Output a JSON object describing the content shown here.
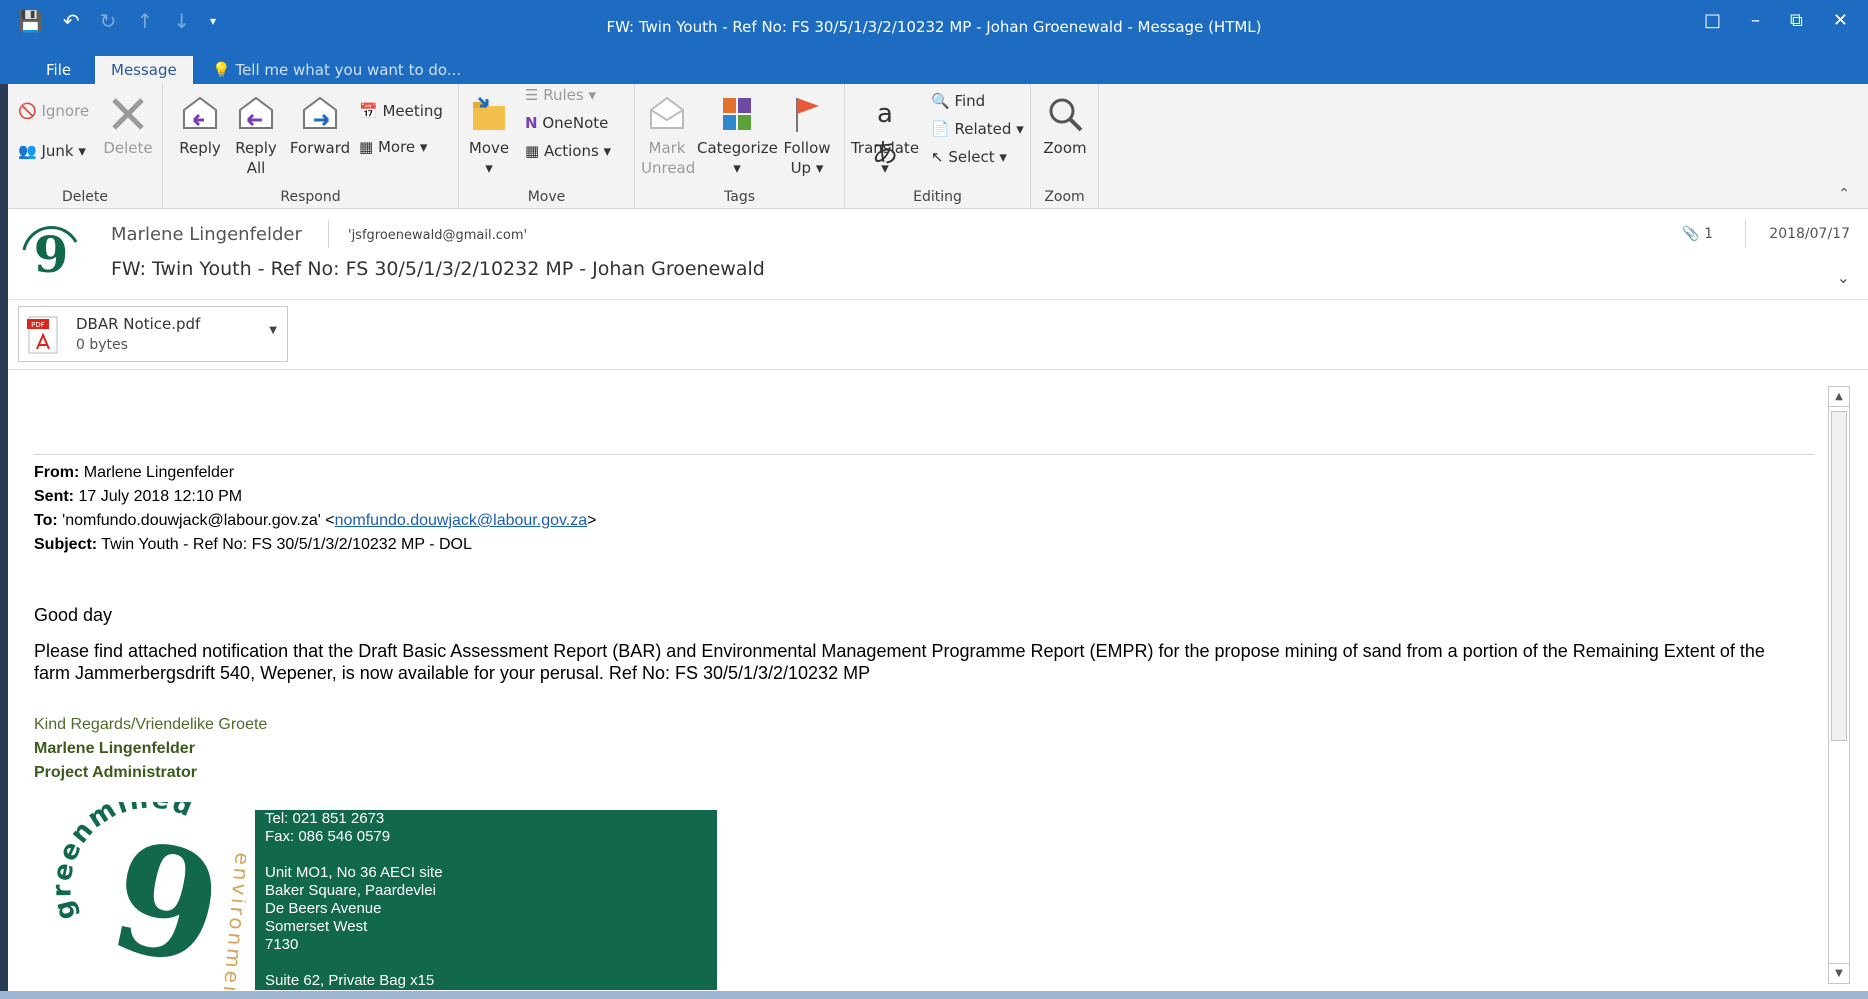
{
  "window": {
    "title": "FW: Twin Youth - Ref No: FS 30/5/1/3/2/10232 MP - Johan Groenewald - Message (HTML)"
  },
  "tabs": {
    "file": "File",
    "message": "Message",
    "tell_me": "Tell me what you want to do..."
  },
  "ribbon": {
    "delete_group": {
      "label": "Delete",
      "ignore": "Ignore",
      "junk": "Junk",
      "delete": "Delete"
    },
    "respond_group": {
      "label": "Respond",
      "reply": "Reply",
      "reply_all_1": "Reply",
      "reply_all_2": "All",
      "forward": "Forward",
      "meeting": "Meeting",
      "more": "More"
    },
    "move_group": {
      "label": "Move",
      "move": "Move",
      "rules": "Rules",
      "onenote": "OneNote",
      "actions": "Actions"
    },
    "tags_group": {
      "label": "Tags",
      "mark_1": "Mark",
      "mark_2": "Unread",
      "categorize": "Categorize",
      "follow_1": "Follow",
      "follow_2": "Up"
    },
    "editing_group": {
      "label": "Editing",
      "translate": "Translate",
      "find": "Find",
      "related": "Related",
      "select": "Select"
    },
    "zoom_group": {
      "label": "Zoom",
      "zoom": "Zoom"
    }
  },
  "message_header": {
    "sender": "Marlene Lingenfelder",
    "recipient": "'jsfgroenewald@gmail.com'",
    "subject": "FW: Twin Youth - Ref No: FS 30/5/1/3/2/10232 MP - Johan Groenewald",
    "attachment_count": "1",
    "date": "2018/07/17"
  },
  "attachment": {
    "name": "DBAR Notice.pdf",
    "size": "0 bytes"
  },
  "body": {
    "from_label": "From:",
    "from_value": "Marlene Lingenfelder",
    "sent_label": "Sent:",
    "sent_value": "17 July 2018 12:10 PM",
    "to_label": "To:",
    "to_value": "'nomfundo.douwjack@labour.gov.za' <",
    "to_link": "nomfundo.douwjack@labour.gov.za",
    "to_close": ">",
    "subject_label": "Subject:",
    "subject_value": "Twin Youth - Ref No: FS 30/5/1/3/2/10232 MP - DOL",
    "greeting": "Good day",
    "paragraph": "Please find attached notification that the Draft Basic Assessment Report (BAR) and Environmental Management Programme Report (EMPR) for the propose mining of sand from a portion of the Remaining Extent of the farm Jammerbergsdrift 540, Wepener, is now available for your perusal. Ref No: FS 30/5/1/3/2/10232 MP",
    "regards": "Kind Regards/Vriendelike Groete",
    "sig_name": "Marlene Lingenfelder",
    "sig_title": "Project Administrator",
    "contact": {
      "tel": "Tel: 021 851 2673",
      "fax": "Fax: 086 546 0579",
      "addr1": "Unit MO1, No 36 AECI site",
      "addr2": "Baker Square, Paardevlei",
      "addr3": "De Beers Avenue",
      "addr4": "Somerset West",
      "addr5": "7130",
      "addr6": "Suite 62, Private Bag x15"
    },
    "logo_text_1": "greenmined",
    "logo_text_2": "environmental"
  },
  "colors": {
    "titlebar": "#1d6cc1",
    "ribbon": "#f3f3f3",
    "signature_green": "#4f6b2b",
    "contact_box": "#11684a",
    "link": "#1a5fb4"
  }
}
